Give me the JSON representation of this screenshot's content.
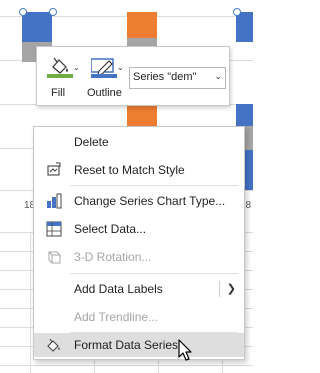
{
  "chart": {
    "axis_labels": [
      "18",
      "1",
      "18"
    ],
    "colors": {
      "blue": "#4472c4",
      "orange": "#ed7d31",
      "gray": "#a5a5a5"
    }
  },
  "mini_toolbar": {
    "fill_label": "Fill",
    "outline_label": "Outline",
    "series_selector_value": "Series \"dem\"",
    "fill_accent": "#70ad47",
    "outline_accent": "#4472c4"
  },
  "context_menu": {
    "items": [
      {
        "label": "Delete",
        "icon": "none",
        "disabled": false
      },
      {
        "label": "Reset to Match Style",
        "icon": "reset-style-icon",
        "disabled": false
      },
      {
        "label": "Change Series Chart Type...",
        "icon": "chart-type-icon",
        "disabled": false
      },
      {
        "label": "Select Data...",
        "icon": "select-data-icon",
        "disabled": false
      },
      {
        "label": "3-D Rotation...",
        "icon": "3d-rotation-icon",
        "disabled": true
      },
      {
        "label": "Add Data Labels",
        "icon": "none",
        "disabled": false,
        "submenu": true
      },
      {
        "label": "Add Trendline...",
        "icon": "none",
        "disabled": true
      },
      {
        "label": "Format Data Series...",
        "icon": "format-series-icon",
        "disabled": false,
        "highlighted": true
      }
    ]
  }
}
